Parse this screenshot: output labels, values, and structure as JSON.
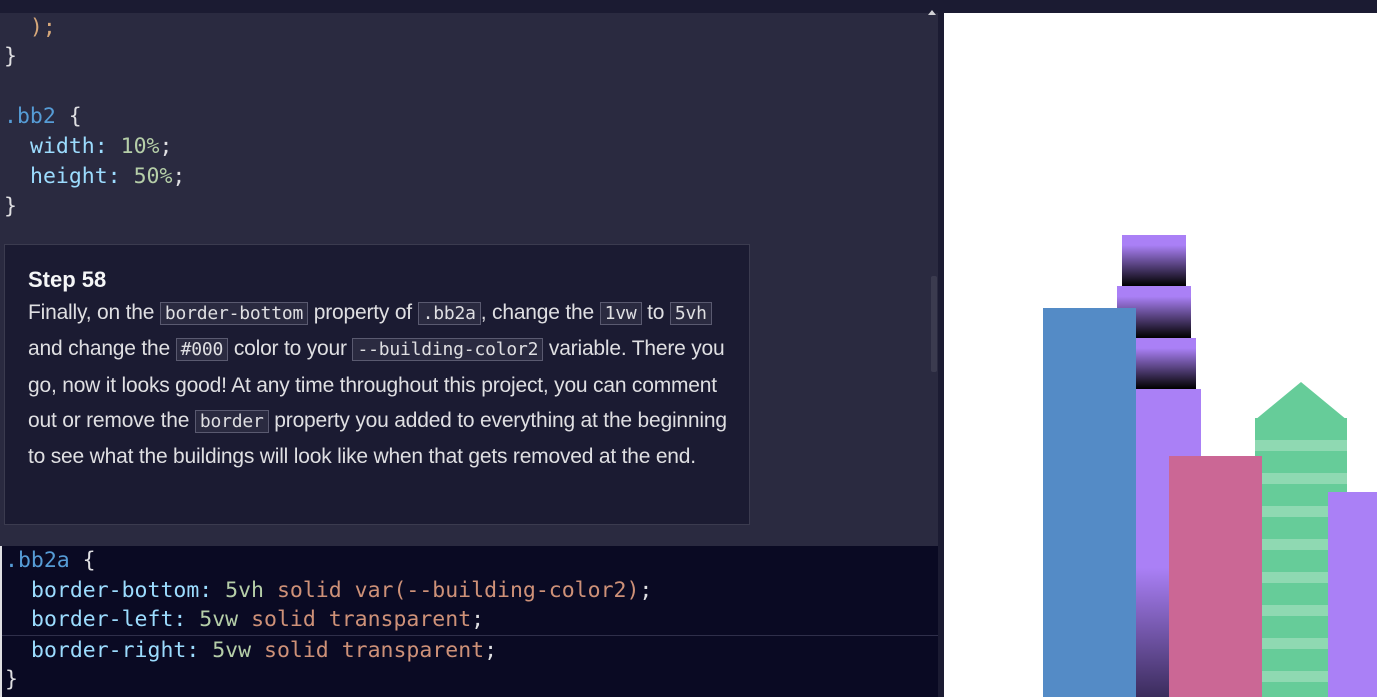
{
  "code_top": {
    "line1": "  );",
    "line2": "}",
    "selector_bb2": ".bb2",
    "brace_open": " {",
    "width_prop": "width:",
    "width_val": "10%",
    "height_prop": "height:",
    "height_val": "50%",
    "semicolon": ";",
    "brace_close": "}"
  },
  "step": {
    "title": "Step 58",
    "t1": "Finally, on the ",
    "c1": "border-bottom",
    "t2": " property of ",
    "c2": ".bb2a",
    "t3": ", change the ",
    "c3": "1vw",
    "t4": " to ",
    "c4": "5vh",
    "t5": " and change the ",
    "c5": "#000",
    "t6": " color to your ",
    "c6": "--building-color2",
    "t7": " variable. There you go, now it looks good! At any time throughout this project, you can comment out or remove the ",
    "c7": "border",
    "t8": " property you added to everything at the beginning to see what the buildings will look like when that gets removed at the end."
  },
  "code_edit": {
    "selector": ".bb2a",
    "brace_open": " {",
    "l1_prop": "border-bottom:",
    "l1_num": "5vh",
    "l1_rest": "solid var(--building-color2)",
    "l2_prop": "border-left:",
    "l2_num": "5vw",
    "l2_rest": "solid transparent",
    "l3_prop": "border-right:",
    "l3_num": "5vw",
    "l3_rest": "solid transparent",
    "semicolon": ";",
    "brace_close": "}"
  },
  "colors": {
    "building_blue": "#548bc6",
    "building_purple": "#aa80f6",
    "building_pink": "#cb6795",
    "building_green": "#66cc99",
    "building_green_stripe": "#8fd9b2"
  }
}
